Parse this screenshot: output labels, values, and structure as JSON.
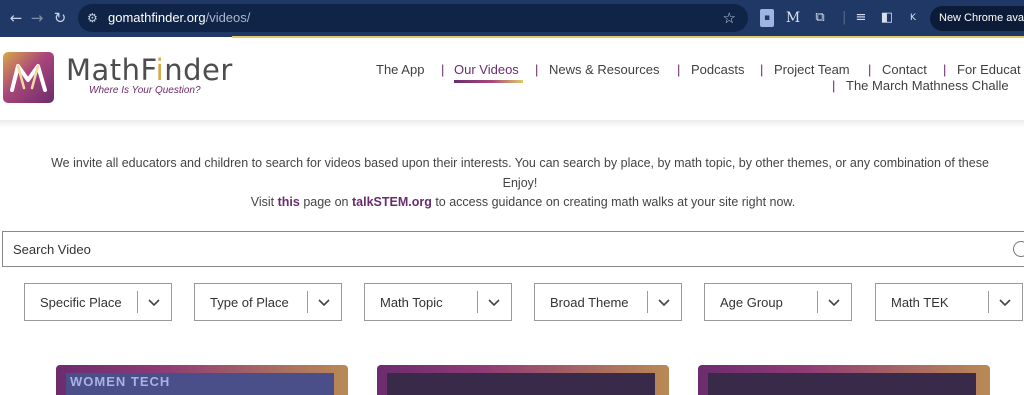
{
  "browser": {
    "url_domain": "gomathfinder.org",
    "url_path": "/videos/",
    "chrome_pill": "New Chrome availa",
    "ext_m": "M",
    "profile_initial": "K"
  },
  "site": {
    "brand_prefix": "MathF",
    "brand_dot_letter": "i",
    "brand_suffix": "nder",
    "tagline": "Where Is Your Question?",
    "colors": {
      "accent_purple": "#6b2c6e",
      "accent_gold": "#e3c96a"
    }
  },
  "nav": {
    "items": [
      {
        "label": "The App"
      },
      {
        "label": "Our Videos"
      },
      {
        "label": "News & Resources"
      },
      {
        "label": "Podcasts"
      },
      {
        "label": "Project Team"
      },
      {
        "label": "Contact"
      },
      {
        "label": "For Educat"
      },
      {
        "label": "The March Mathness Challe"
      }
    ],
    "separator": "|"
  },
  "intro": {
    "line1": "We invite all educators and children to search for videos based upon their interests. You can search by place, by math topic, by other themes, or any combination of these",
    "line2": "Enjoy!",
    "visit_prefix": "Visit ",
    "visit_link1": "this",
    "visit_mid": " page on ",
    "visit_link2": "talkSTEM.org",
    "visit_suffix": " to access guidance on creating math walks at your site right now."
  },
  "search": {
    "placeholder": "Search Video"
  },
  "filters": [
    {
      "label": "Specific Place"
    },
    {
      "label": "Type of Place"
    },
    {
      "label": "Math Topic"
    },
    {
      "label": "Broad Theme"
    },
    {
      "label": "Age Group"
    },
    {
      "label": "Math TEK"
    }
  ],
  "cards": [
    {
      "title": "WOMEN TECH"
    },
    {
      "title": ""
    },
    {
      "title": ""
    }
  ]
}
